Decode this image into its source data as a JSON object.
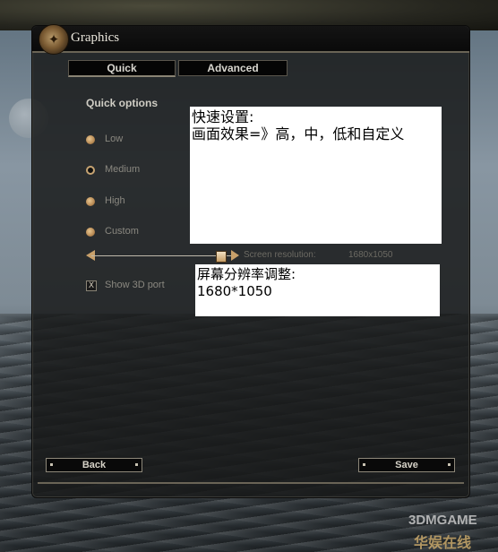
{
  "window": {
    "title": "Graphics",
    "emblem_icon": "crest-icon"
  },
  "tabs": [
    {
      "label": "Quick",
      "active": true
    },
    {
      "label": "Advanced",
      "active": false
    }
  ],
  "quick_options": {
    "heading": "Quick options",
    "options": [
      {
        "label": "Low",
        "selected": false
      },
      {
        "label": "Medium",
        "selected": true
      },
      {
        "label": "High",
        "selected": false
      },
      {
        "label": "Custom",
        "selected": false
      }
    ]
  },
  "resolution": {
    "label": "Screen resolution:",
    "value": "1680x1050"
  },
  "show_3d_port": {
    "label": "Show 3D port",
    "checked": true,
    "mark": "X"
  },
  "buttons": {
    "back": "Back",
    "save": "Save"
  },
  "annotations": {
    "note1": "快速设置:\n画面效果=》高，中，低和自定义",
    "note2": "屏幕分辨率调整:\n1680*1050"
  },
  "watermark": {
    "line1": "3DMGAME",
    "line2": "华娱在线"
  },
  "colors": {
    "accent_gold": "#c8a06a",
    "panel_bg": "#181919",
    "text_light": "#d8d6cf",
    "text_dim": "#8a8880"
  }
}
